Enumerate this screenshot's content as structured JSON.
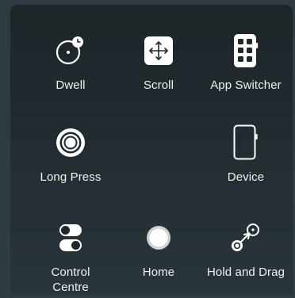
{
  "menu": {
    "items": [
      {
        "id": "dwell",
        "label": "Dwell",
        "icon": "dwell-icon"
      },
      {
        "id": "scroll",
        "label": "Scroll",
        "icon": "scroll-icon"
      },
      {
        "id": "app-switcher",
        "label": "App Switcher",
        "icon": "app-switcher-icon"
      },
      {
        "id": "long-press",
        "label": "Long Press",
        "icon": "long-press-icon"
      },
      {
        "id": "device",
        "label": "Device",
        "icon": "device-icon"
      },
      {
        "id": "control-centre",
        "label": "Control\nCentre",
        "icon": "control-centre-icon"
      },
      {
        "id": "home",
        "label": "Home",
        "icon": "home-icon"
      },
      {
        "id": "hold-and-drag",
        "label": "Hold and Drag",
        "icon": "hold-and-drag-icon"
      }
    ]
  },
  "colors": {
    "panel": "#1f282c",
    "backdrop": "#2f3a41",
    "icon": "#ffffff",
    "text": "#f2f2f2"
  }
}
